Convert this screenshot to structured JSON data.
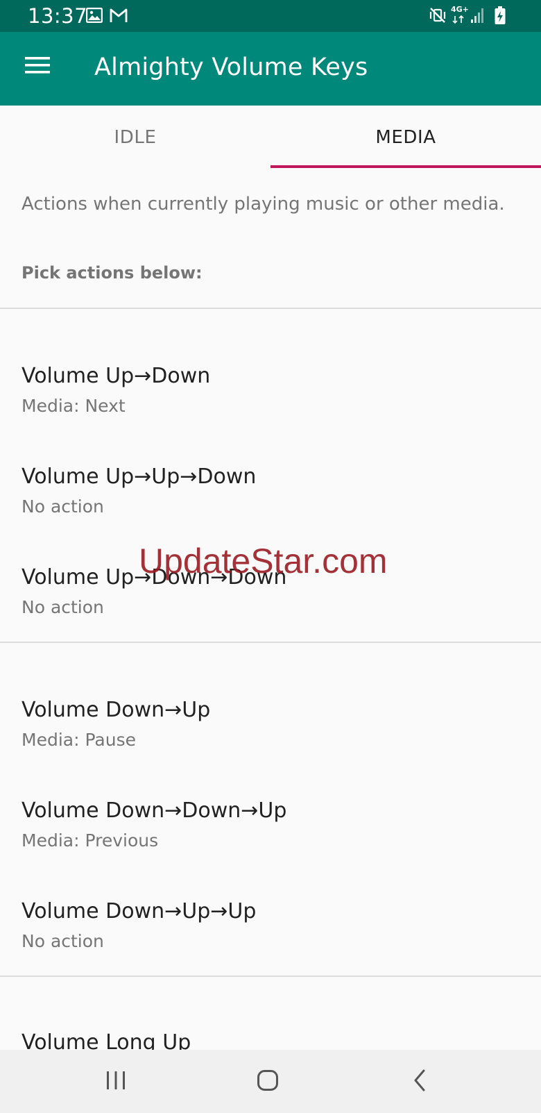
{
  "status_bar": {
    "time": "13:37",
    "left_icons": [
      "image-icon",
      "gmail-icon"
    ],
    "right_icons": [
      "mute-vibrate-icon",
      "4g-icon",
      "signal-icon",
      "battery-charging-icon"
    ],
    "network_label": "4G+"
  },
  "app_bar": {
    "title": "Almighty Volume Keys",
    "menu_icon": "hamburger-menu-icon"
  },
  "tabs": [
    {
      "label": "IDLE",
      "selected": false
    },
    {
      "label": "MEDIA",
      "selected": true
    }
  ],
  "colors": {
    "status_bar": "#00695c",
    "app_bar": "#00897b",
    "tab_indicator": "#c2185b",
    "watermark": "#9b1c24"
  },
  "content": {
    "description": "Actions when currently playing music or other media.",
    "pick_label": "Pick actions below:",
    "groups": [
      {
        "items": [
          {
            "title": "Volume Up→Down",
            "summary": "Media: Next"
          },
          {
            "title": "Volume Up→Up→Down",
            "summary": "No action"
          },
          {
            "title": "Volume Up→Down→Down",
            "summary": "No action"
          }
        ]
      },
      {
        "items": [
          {
            "title": "Volume Down→Up",
            "summary": "Media: Pause"
          },
          {
            "title": "Volume Down→Down→Up",
            "summary": "Media: Previous"
          },
          {
            "title": "Volume Down→Up→Up",
            "summary": "No action"
          }
        ]
      }
    ],
    "partial_item_title": "Volume Long Up"
  },
  "watermark": "UpdateStar.com",
  "nav_bar": {
    "buttons": [
      "recent-apps-icon",
      "home-icon",
      "back-icon"
    ]
  }
}
